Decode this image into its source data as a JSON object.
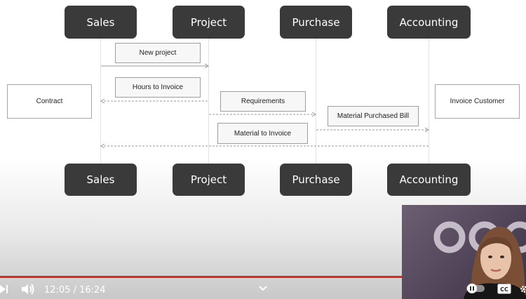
{
  "diagram": {
    "roles_top": [
      "Sales",
      "Project",
      "Purchase",
      "Accounting"
    ],
    "roles_bottom": [
      "Sales",
      "Project",
      "Purchase",
      "Accounting"
    ],
    "notes": {
      "new_project": "New project",
      "hours_to_invoice": "Hours to Invoice",
      "requirements": "Requirements",
      "material_purchased_bill": "Material Purchased Bill",
      "material_to_invoice": "Material to Invoice"
    },
    "endpoints": {
      "contract": "Contract",
      "invoice_customer": "Invoice Customer"
    }
  },
  "player": {
    "current_time": "12:05",
    "duration": "16:24",
    "time_display": "12:05 / 16:24",
    "progress_fraction": 0.737,
    "accent_color": "#e62117",
    "icons": [
      "next-icon",
      "volume-icon",
      "chevron-down-icon",
      "pause-icon",
      "toggle-icon",
      "cc-icon",
      "settings-icon"
    ],
    "cc_label": "CC"
  }
}
